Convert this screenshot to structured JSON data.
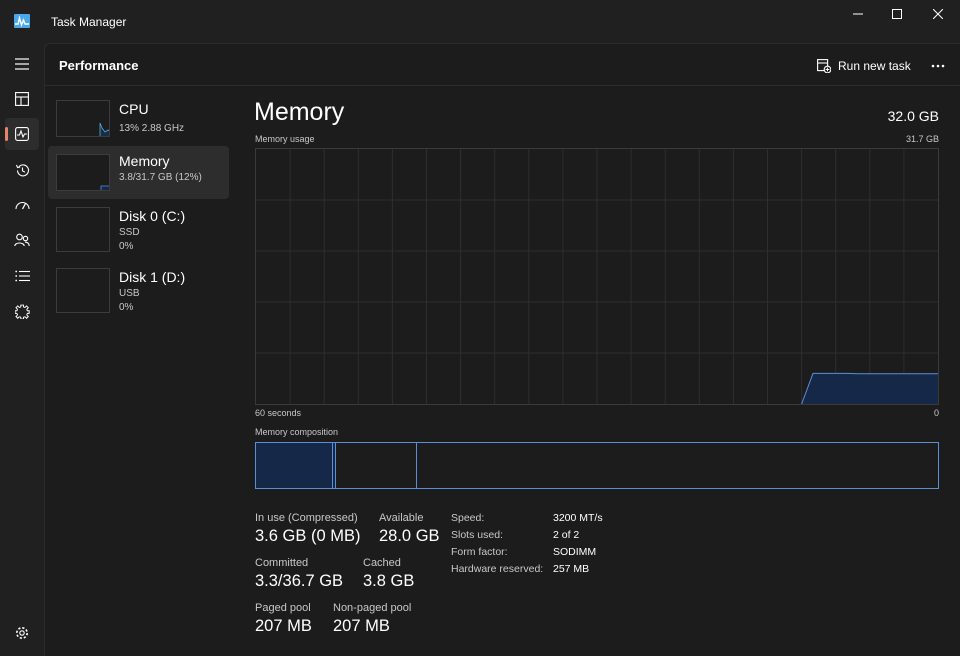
{
  "window": {
    "title": "Task Manager",
    "controls": [
      "minimize",
      "maximize",
      "close"
    ]
  },
  "nav_rail": {
    "items": [
      {
        "icon": "hamburger-menu-icon",
        "label": "Menu"
      },
      {
        "icon": "processes-icon",
        "label": "Processes"
      },
      {
        "icon": "performance-icon",
        "label": "Performance",
        "active": true
      },
      {
        "icon": "app-history-icon",
        "label": "App history"
      },
      {
        "icon": "startup-apps-icon",
        "label": "Startup apps"
      },
      {
        "icon": "users-icon",
        "label": "Users"
      },
      {
        "icon": "details-icon",
        "label": "Details"
      },
      {
        "icon": "services-icon",
        "label": "Services"
      }
    ],
    "settings_icon": "settings-gear-icon",
    "accent_color": "#e8836b"
  },
  "header": {
    "title": "Performance",
    "run_new_task_label": "Run new task",
    "more_icon": "more-options-icon"
  },
  "perf_list": [
    {
      "name": "CPU",
      "line1": "13%  2.88 GHz",
      "color": "#5aa9d6",
      "selected": false
    },
    {
      "name": "Memory",
      "line1": "3.8/31.7 GB (12%)",
      "color": "#5a8fd6",
      "selected": true
    },
    {
      "name": "Disk 0 (C:)",
      "line1": "SSD",
      "line2": "0%",
      "color": "#6bbf59",
      "selected": false
    },
    {
      "name": "Disk 1 (D:)",
      "line1": "USB",
      "line2": "0%",
      "color": "#9acd32",
      "selected": false
    }
  ],
  "memory": {
    "title": "Memory",
    "total": "32.0 GB",
    "usage_label": "Memory usage",
    "usage_max": "31.7 GB",
    "axis_left": "60 seconds",
    "axis_right": "0",
    "composition_label": "Memory composition",
    "usage_series": [
      null,
      null,
      null,
      null,
      null,
      null,
      null,
      null,
      null,
      null,
      null,
      null,
      null,
      null,
      null,
      null,
      null,
      null,
      null,
      null,
      null,
      null,
      null,
      null,
      null,
      null,
      null,
      null,
      null,
      null,
      null,
      null,
      null,
      null,
      null,
      null,
      null,
      null,
      null,
      null,
      null,
      null,
      null,
      null,
      null,
      null,
      null,
      null,
      null,
      3.8,
      3.8,
      3.8,
      3.8,
      3.75,
      3.75,
      3.75,
      3.75,
      3.75,
      3.75,
      3.75,
      3.75
    ],
    "usage_ymax": 31.7,
    "composition": {
      "in_use_gb": 3.6,
      "modified_gb": 0.1,
      "standby_gb": 3.8,
      "free_gb": 24.2,
      "total_gb": 31.7
    },
    "stats": {
      "in_use_label": "In use (Compressed)",
      "in_use_value": "3.6 GB (0 MB)",
      "available_label": "Available",
      "available_value": "28.0 GB",
      "committed_label": "Committed",
      "committed_value": "3.3/36.7 GB",
      "cached_label": "Cached",
      "cached_value": "3.8 GB",
      "paged_pool_label": "Paged pool",
      "paged_pool_value": "207 MB",
      "non_paged_pool_label": "Non-paged pool",
      "non_paged_pool_value": "207 MB"
    },
    "details": [
      {
        "key": "Speed:",
        "value": "3200 MT/s"
      },
      {
        "key": "Slots used:",
        "value": "2 of 2"
      },
      {
        "key": "Form factor:",
        "value": "SODIMM"
      },
      {
        "key": "Hardware reserved:",
        "value": "257 MB"
      }
    ],
    "colors": {
      "line": "#5a8fd6",
      "fill": "#152848",
      "grid": "#2e2e2e"
    }
  }
}
